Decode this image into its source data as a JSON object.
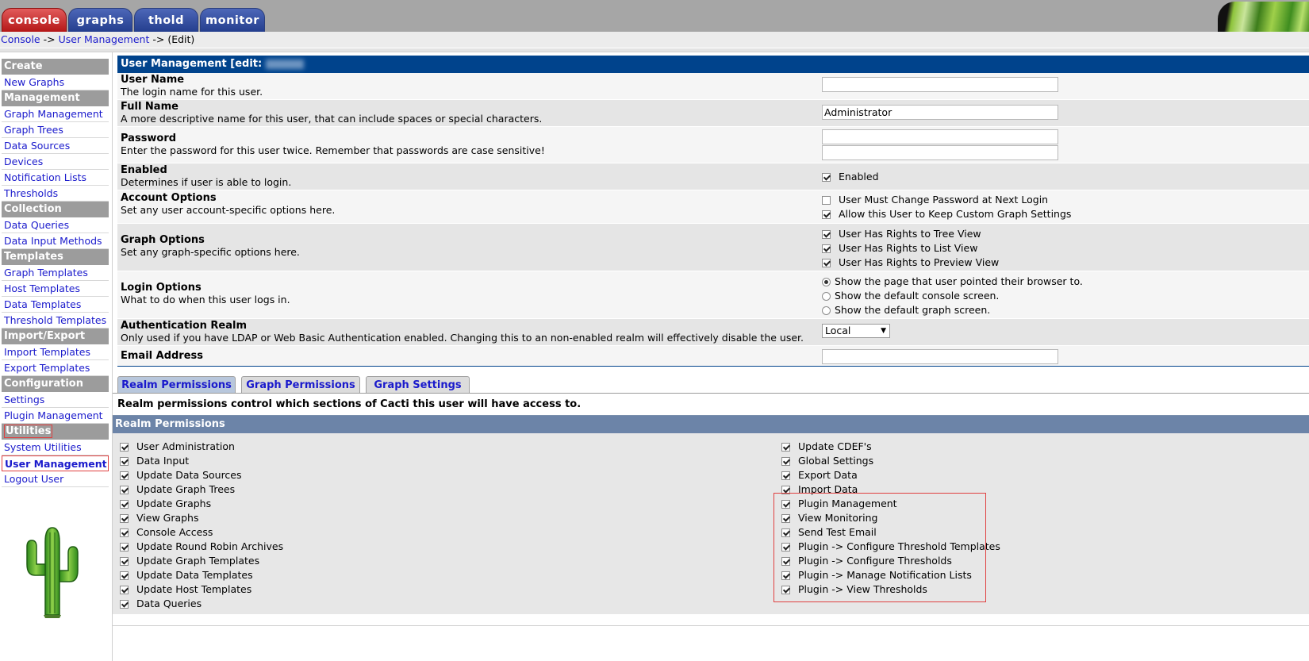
{
  "top_tabs": [
    {
      "label": "console"
    },
    {
      "label": "graphs"
    },
    {
      "label": "thold"
    },
    {
      "label": "monitor"
    }
  ],
  "breadcrumb": {
    "console": "Console",
    "sep1": " -> ",
    "user_management": "User Management",
    "sep2": " -> ",
    "current": "(Edit)"
  },
  "sidebar": {
    "create": {
      "header": "Create",
      "items": [
        "New Graphs"
      ]
    },
    "management": {
      "header": "Management",
      "items": [
        "Graph Management",
        "Graph Trees",
        "Data Sources",
        "Devices",
        "Notification Lists",
        "Thresholds"
      ]
    },
    "collection": {
      "header": "Collection Methods",
      "items": [
        "Data Queries",
        "Data Input Methods"
      ]
    },
    "templates": {
      "header": "Templates",
      "items": [
        "Graph Templates",
        "Host Templates",
        "Data Templates",
        "Threshold Templates"
      ]
    },
    "import_export": {
      "header": "Import/Export",
      "items": [
        "Import Templates",
        "Export Templates"
      ]
    },
    "configuration": {
      "header": "Configuration",
      "items": [
        "Settings",
        "Plugin Management"
      ]
    },
    "utilities": {
      "header": "Utilities",
      "items": [
        "System Utilities",
        "User Management",
        "Logout User"
      ]
    }
  },
  "form": {
    "header": "User Management [edit:",
    "user_name": {
      "title": "User Name",
      "desc": "The login name for this user.",
      "value": ""
    },
    "full_name": {
      "title": "Full Name",
      "desc": "A more descriptive name for this user, that can include spaces or special characters.",
      "value": "Administrator"
    },
    "password": {
      "title": "Password",
      "desc": "Enter the password for this user twice. Remember that passwords are case sensitive!"
    },
    "enabled": {
      "title": "Enabled",
      "desc": "Determines if user is able to login.",
      "option": "Enabled",
      "checked": true
    },
    "account_options": {
      "title": "Account Options",
      "desc": "Set any user account-specific options here.",
      "options": [
        {
          "label": "User Must Change Password at Next Login",
          "checked": false
        },
        {
          "label": "Allow this User to Keep Custom Graph Settings",
          "checked": true
        }
      ]
    },
    "graph_options": {
      "title": "Graph Options",
      "desc": "Set any graph-specific options here.",
      "options": [
        {
          "label": "User Has Rights to Tree View",
          "checked": true
        },
        {
          "label": "User Has Rights to List View",
          "checked": true
        },
        {
          "label": "User Has Rights to Preview View",
          "checked": true
        }
      ]
    },
    "login_options": {
      "title": "Login Options",
      "desc": "What to do when this user logs in.",
      "options": [
        {
          "label": "Show the page that user pointed their browser to.",
          "checked": true
        },
        {
          "label": "Show the default console screen.",
          "checked": false
        },
        {
          "label": "Show the default graph screen.",
          "checked": false
        }
      ]
    },
    "auth_realm": {
      "title": "Authentication Realm",
      "desc": "Only used if you have LDAP or Web Basic Authentication enabled. Changing this to an non-enabled realm will effectively disable the user.",
      "selected": "Local"
    },
    "email": {
      "title": "Email Address",
      "value": ""
    }
  },
  "perm_tabs": [
    "Realm Permissions",
    "Graph Permissions",
    "Graph Settings"
  ],
  "realm_intro": "Realm permissions control which sections of Cacti this user will have access to.",
  "realm_header": "Realm Permissions",
  "realm_left": [
    "User Administration",
    "Data Input",
    "Update Data Sources",
    "Update Graph Trees",
    "Update Graphs",
    "View Graphs",
    "Console Access",
    "Update Round Robin Archives",
    "Update Graph Templates",
    "Update Data Templates",
    "Update Host Templates",
    "Data Queries"
  ],
  "realm_right": [
    "Update CDEF's",
    "Global Settings",
    "Export Data",
    "Import Data",
    "Plugin Management",
    "View Monitoring",
    "Send Test Email",
    "Plugin -> Configure Threshold Templates",
    "Plugin -> Configure Thresholds",
    "Plugin -> Manage Notification Lists",
    "Plugin -> View Thresholds"
  ],
  "colors": {
    "form_header": "#00438c",
    "realm_header": "#6c84a8",
    "sidebar_header": "#9c9c9c",
    "link": "#1a1acc",
    "highlight": "#e04040"
  },
  "icons": {
    "logo": "cactus-icon",
    "banner": "cactus-banner",
    "dropdown": "chevron-down-icon"
  }
}
